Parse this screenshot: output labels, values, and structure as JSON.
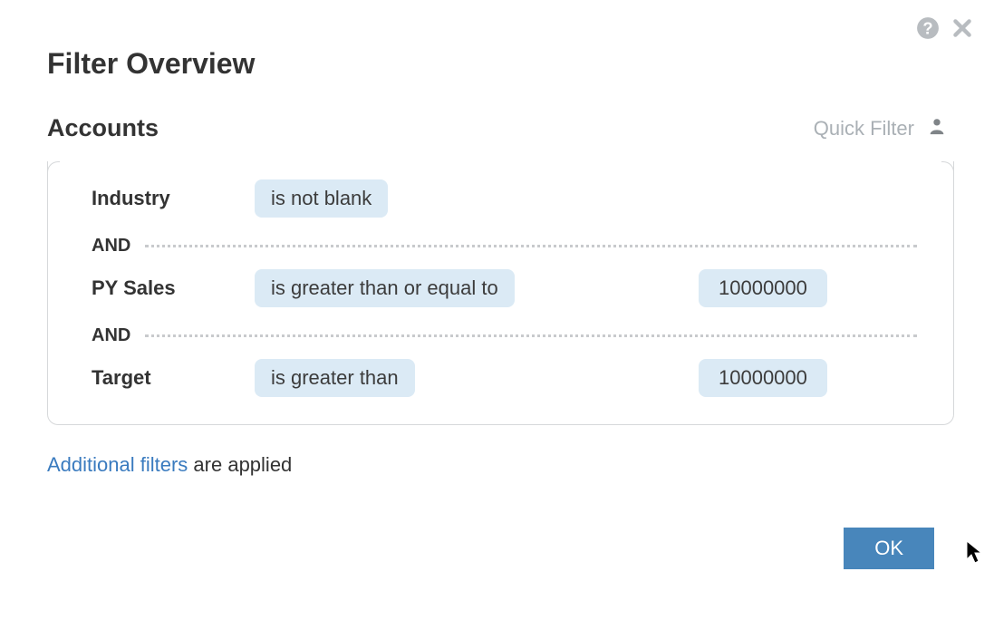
{
  "title": "Filter Overview",
  "section": {
    "title": "Accounts",
    "quick_filter_label": "Quick Filter"
  },
  "logic": {
    "and_label": "AND"
  },
  "rows": [
    {
      "field": "Industry",
      "operator": "is not blank",
      "value": ""
    },
    {
      "field": "PY Sales",
      "operator": "is greater than or equal to",
      "value": "10000000"
    },
    {
      "field": "Target",
      "operator": "is greater than",
      "value": "10000000"
    }
  ],
  "additional": {
    "link": "Additional filters",
    "suffix": " are applied"
  },
  "buttons": {
    "ok": "OK"
  }
}
